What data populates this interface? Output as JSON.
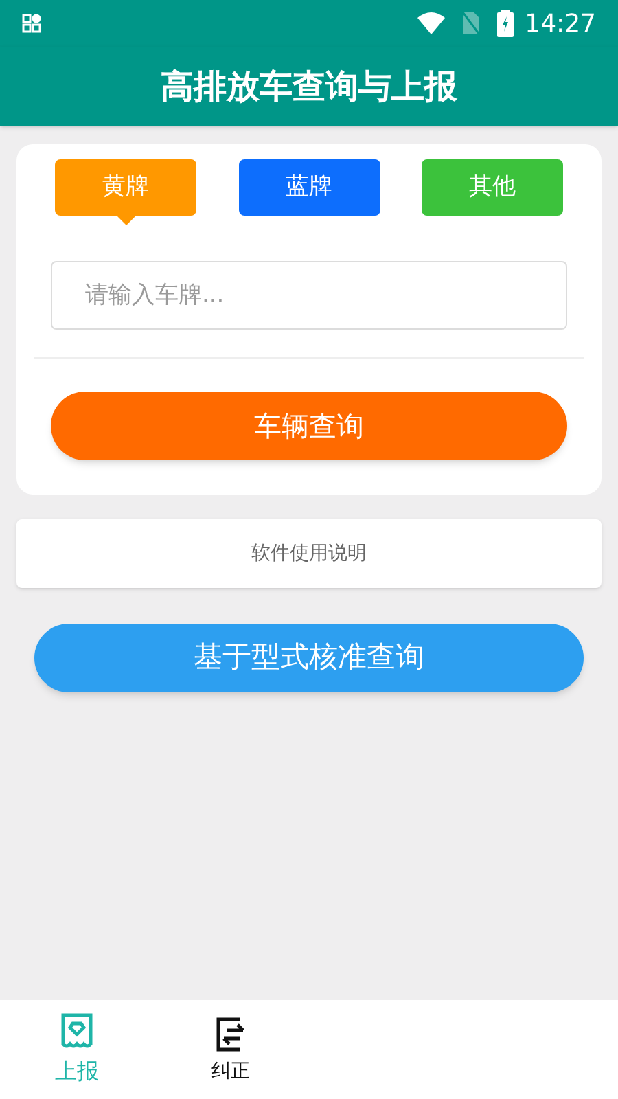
{
  "status_bar": {
    "time": "14:27"
  },
  "app_bar": {
    "title": "高排放车查询与上报"
  },
  "plate_types": [
    {
      "label": "黄牌",
      "color": "#ff9800",
      "selected": true
    },
    {
      "label": "蓝牌",
      "color": "#0d6efd",
      "selected": false
    },
    {
      "label": "其他",
      "color": "#3cc23c",
      "selected": false
    }
  ],
  "plate_input": {
    "placeholder": "请输入车牌..."
  },
  "query_button": "车辆查询",
  "instructions": "软件使用说明",
  "type_approval_button": "基于型式核准查询",
  "bottom_nav": [
    {
      "label": "上报",
      "selected": true,
      "kind": "report"
    },
    {
      "label": "纠正",
      "selected": false,
      "kind": "correct"
    }
  ]
}
